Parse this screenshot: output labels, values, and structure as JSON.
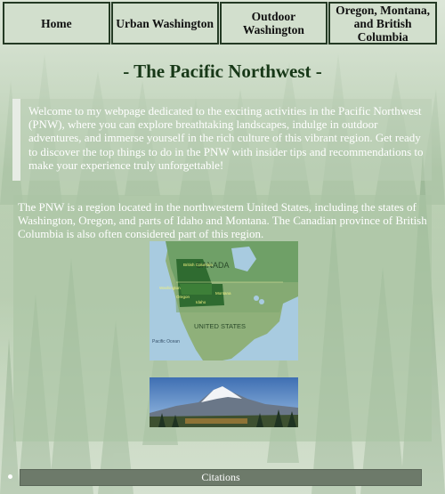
{
  "nav": {
    "items": [
      {
        "label": "Home"
      },
      {
        "label": "Urban Washington"
      },
      {
        "label": "Outdoor Washington"
      },
      {
        "label": "Oregon, Montana, and British Columbia"
      }
    ]
  },
  "page_title": "- The Pacific Northwest -",
  "intro": {
    "text": "Welcome to my webpage dedicated to the exciting activities in the Pacific Northwest (PNW), where you can explore breathtaking landscapes, indulge in outdoor adventures, and immerse yourself in the rich culture of this vibrant region. Get ready to discover the top things to do in the PNW with insider tips and recommendations to make your experience truly unforgettable!"
  },
  "main": {
    "text": "The PNW is a region located in the northwestern United States, including the states of Washington, Oregon, and parts of Idaho and Montana. The Canadian province of British Columbia is also often considered part of this region.",
    "map": {
      "labels": {
        "canada": "CANADA",
        "united_states": "UNITED STATES",
        "pacific_ocean": "Pacific Ocean",
        "british_columbia": "British Columbia",
        "washington": "Washington",
        "oregon": "Oregon",
        "idaho": "Idaho",
        "montana": "Montana"
      }
    }
  },
  "footer": {
    "citations_label": "Citations"
  }
}
